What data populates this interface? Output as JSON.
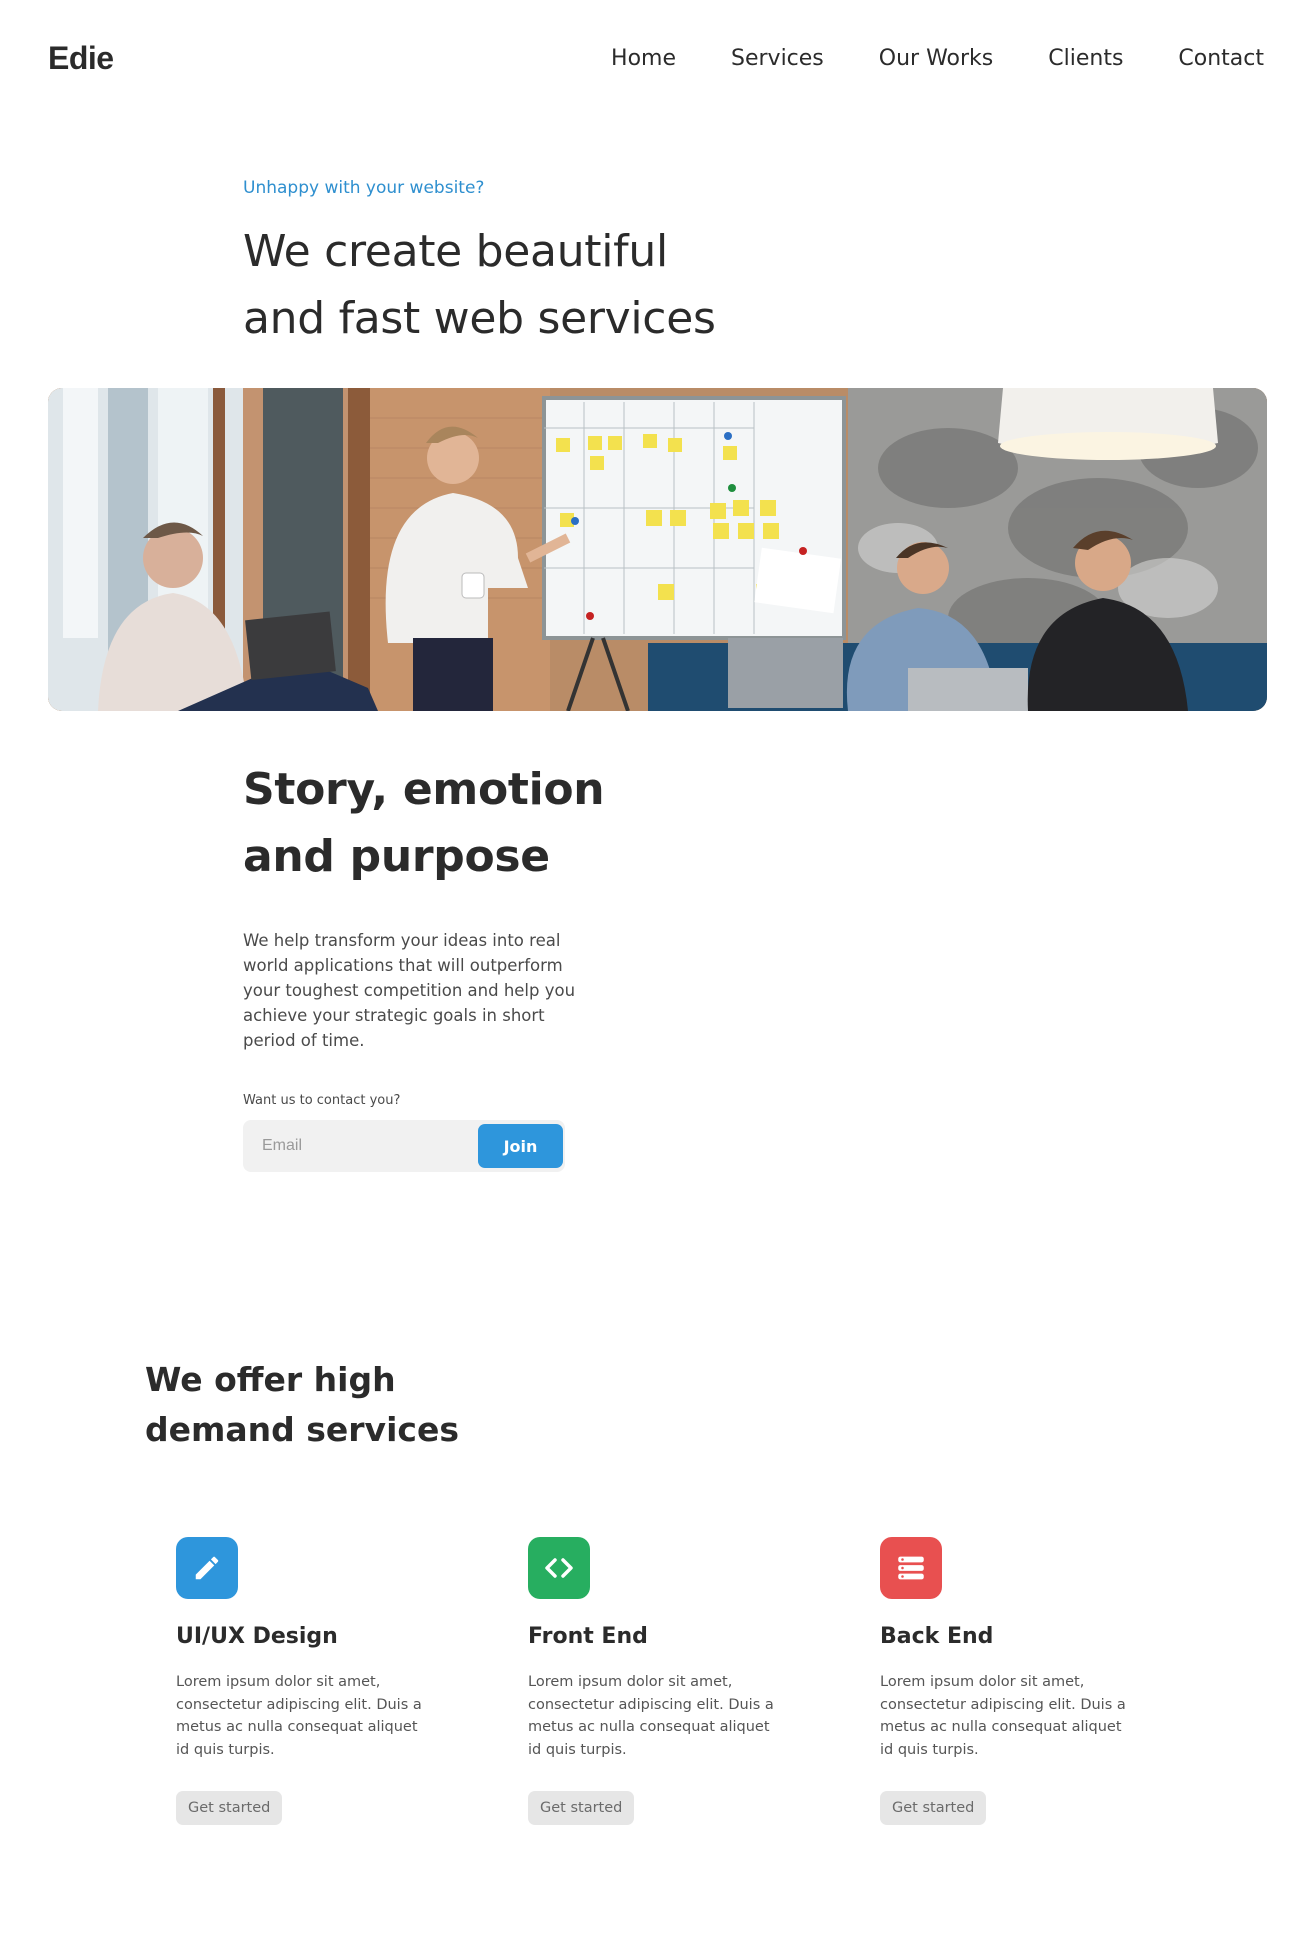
{
  "header": {
    "logo": "Edie",
    "nav": [
      "Home",
      "Services",
      "Our Works",
      "Clients",
      "Contact"
    ]
  },
  "hero": {
    "eyebrow": "Unhappy with your website?",
    "title_line1": "We create beautiful",
    "title_line2": "and fast web services",
    "image_description_icon": "team-meeting-photo"
  },
  "story": {
    "title_line1": "Story, emotion",
    "title_line2": "and purpose",
    "text": "We help transform your ideas into real world applications that will outperform your toughest competition and help you achieve your strategic goals in short period of time.",
    "contact_label": "Want us to contact you?",
    "email_placeholder": "Email",
    "join_label": "Join"
  },
  "services": {
    "title_line1": "We offer high",
    "title_line2": "demand services",
    "cards": [
      {
        "icon": "pencil-icon",
        "color": "#2e96dc",
        "title": "UI/UX Design",
        "text": "Lorem ipsum dolor sit amet, consectetur adipiscing elit. Duis a metus ac nulla consequat aliquet id quis turpis.",
        "button": "Get started"
      },
      {
        "icon": "code-icon",
        "color": "#27ae60",
        "title": "Front End",
        "text": "Lorem ipsum dolor sit amet, consectetur adipiscing elit. Duis a metus ac nulla consequat aliquet id quis turpis.",
        "button": "Get started"
      },
      {
        "icon": "server-icon",
        "color": "#e85050",
        "title": "Back End",
        "text": "Lorem ipsum dolor sit amet, consectetur adipiscing elit. Duis a metus ac nulla consequat aliquet id quis turpis.",
        "button": "Get started"
      }
    ]
  }
}
